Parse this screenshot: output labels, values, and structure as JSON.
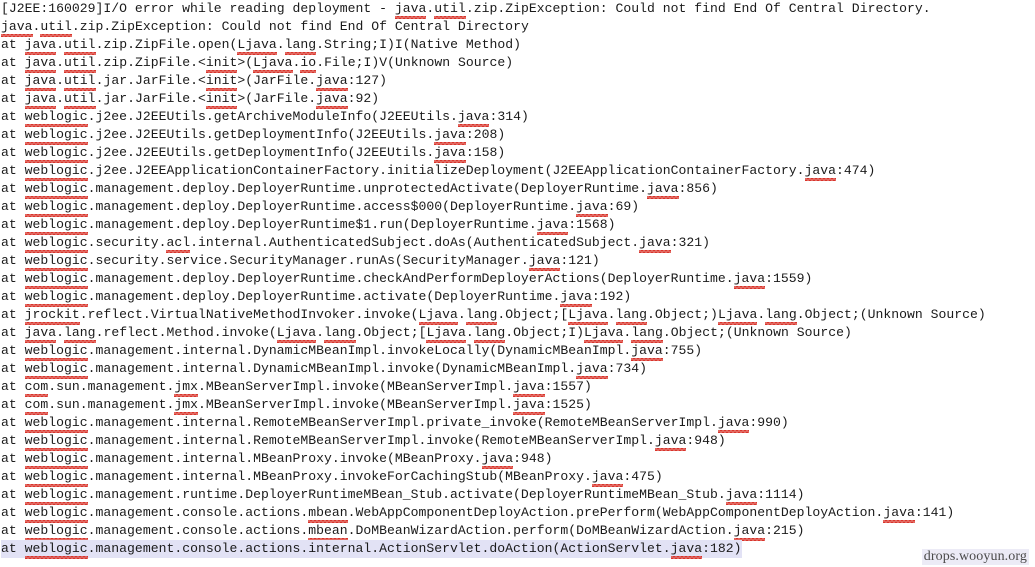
{
  "document": {
    "kind": "java-exception-stack-trace",
    "watermark": "drops.wooyun.org"
  },
  "trace": {
    "lines": [
      {
        "text": "[J2EE:160029]I/O error while reading deployment - java.util.zip.ZipException: Could not find End Of Central Directory.",
        "selected": false,
        "misspelled": [
          "java",
          "util",
          "java",
          "util"
        ]
      },
      {
        "text": "java.util.zip.ZipException: Could not find End Of Central Directory",
        "selected": false,
        "misspelled": [
          "java",
          "util"
        ]
      },
      {
        "text": "at java.util.zip.ZipFile.open(Ljava.lang.String;I)I(Native Method)",
        "selected": false,
        "misspelled": [
          "java",
          "util",
          "Ljava",
          "lang"
        ]
      },
      {
        "text": "at java.util.zip.ZipFile.<init>(Ljava.io.File;I)V(Unknown Source)",
        "selected": false,
        "misspelled": [
          "java",
          "util",
          "init",
          "Ljava",
          "io"
        ]
      },
      {
        "text": "at java.util.jar.JarFile.<init>(JarFile.java:127)",
        "selected": false,
        "misspelled": [
          "java",
          "util",
          "init",
          "java"
        ]
      },
      {
        "text": "at java.util.jar.JarFile.<init>(JarFile.java:92)",
        "selected": false,
        "misspelled": [
          "java",
          "util",
          "init",
          "java"
        ]
      },
      {
        "text": "at weblogic.j2ee.J2EEUtils.getArchiveModuleInfo(J2EEUtils.java:314)",
        "selected": false,
        "misspelled": [
          "weblogic",
          "java"
        ]
      },
      {
        "text": "at weblogic.j2ee.J2EEUtils.getDeploymentInfo(J2EEUtils.java:208)",
        "selected": false,
        "misspelled": [
          "weblogic",
          "java"
        ]
      },
      {
        "text": "at weblogic.j2ee.J2EEUtils.getDeploymentInfo(J2EEUtils.java:158)",
        "selected": false,
        "misspelled": [
          "weblogic",
          "java"
        ]
      },
      {
        "text": "at weblogic.j2ee.J2EEApplicationContainerFactory.initializeDeployment(J2EEApplicationContainerFactory.java:474)",
        "selected": false,
        "misspelled": [
          "weblogic",
          "java"
        ]
      },
      {
        "text": "at weblogic.management.deploy.DeployerRuntime.unprotectedActivate(DeployerRuntime.java:856)",
        "selected": false,
        "misspelled": [
          "weblogic",
          "java"
        ]
      },
      {
        "text": "at weblogic.management.deploy.DeployerRuntime.access$000(DeployerRuntime.java:69)",
        "selected": false,
        "misspelled": [
          "weblogic",
          "java"
        ]
      },
      {
        "text": "at weblogic.management.deploy.DeployerRuntime$1.run(DeployerRuntime.java:1568)",
        "selected": false,
        "misspelled": [
          "weblogic",
          "java"
        ]
      },
      {
        "text": "at weblogic.security.acl.internal.AuthenticatedSubject.doAs(AuthenticatedSubject.java:321)",
        "selected": false,
        "misspelled": [
          "weblogic",
          "acl",
          "java"
        ]
      },
      {
        "text": "at weblogic.security.service.SecurityManager.runAs(SecurityManager.java:121)",
        "selected": false,
        "misspelled": [
          "weblogic",
          "java"
        ]
      },
      {
        "text": "at weblogic.management.deploy.DeployerRuntime.checkAndPerformDeployerActions(DeployerRuntime.java:1559)",
        "selected": false,
        "misspelled": [
          "weblogic",
          "java"
        ]
      },
      {
        "text": "at weblogic.management.deploy.DeployerRuntime.activate(DeployerRuntime.java:192)",
        "selected": false,
        "misspelled": [
          "weblogic",
          "java"
        ]
      },
      {
        "text": "at jrockit.reflect.VirtualNativeMethodInvoker.invoke(Ljava.lang.Object;[Ljava.lang.Object;)Ljava.lang.Object;(Unknown Source)",
        "selected": false,
        "misspelled": [
          "jrockit",
          "Ljava",
          "lang",
          "Ljava",
          "lang",
          "Ljava",
          "lang"
        ]
      },
      {
        "text": "at java.lang.reflect.Method.invoke(Ljava.lang.Object;[Ljava.lang.Object;I)Ljava.lang.Object;(Unknown Source)",
        "selected": false,
        "misspelled": [
          "java",
          "lang",
          "Ljava",
          "lang",
          "Ljava",
          "lang",
          "Ljava",
          "lang"
        ]
      },
      {
        "text": "at weblogic.management.internal.DynamicMBeanImpl.invokeLocally(DynamicMBeanImpl.java:755)",
        "selected": false,
        "misspelled": [
          "weblogic",
          "java"
        ]
      },
      {
        "text": "at weblogic.management.internal.DynamicMBeanImpl.invoke(DynamicMBeanImpl.java:734)",
        "selected": false,
        "misspelled": [
          "weblogic",
          "java"
        ]
      },
      {
        "text": "at com.sun.management.jmx.MBeanServerImpl.invoke(MBeanServerImpl.java:1557)",
        "selected": false,
        "misspelled": [
          "com",
          "jmx",
          "java"
        ]
      },
      {
        "text": "at com.sun.management.jmx.MBeanServerImpl.invoke(MBeanServerImpl.java:1525)",
        "selected": false,
        "misspelled": [
          "com",
          "jmx",
          "java"
        ]
      },
      {
        "text": "at weblogic.management.internal.RemoteMBeanServerImpl.private_invoke(RemoteMBeanServerImpl.java:990)",
        "selected": false,
        "misspelled": [
          "weblogic",
          "java"
        ]
      },
      {
        "text": "at weblogic.management.internal.RemoteMBeanServerImpl.invoke(RemoteMBeanServerImpl.java:948)",
        "selected": false,
        "misspelled": [
          "weblogic",
          "java"
        ]
      },
      {
        "text": "at weblogic.management.internal.MBeanProxy.invoke(MBeanProxy.java:948)",
        "selected": false,
        "misspelled": [
          "weblogic",
          "java"
        ]
      },
      {
        "text": "at weblogic.management.internal.MBeanProxy.invokeForCachingStub(MBeanProxy.java:475)",
        "selected": false,
        "misspelled": [
          "weblogic",
          "java"
        ]
      },
      {
        "text": "at weblogic.management.runtime.DeployerRuntimeMBean_Stub.activate(DeployerRuntimeMBean_Stub.java:1114)",
        "selected": false,
        "misspelled": [
          "weblogic",
          "java"
        ]
      },
      {
        "text": "at weblogic.management.console.actions.mbean.WebAppComponentDeployAction.prePerform(WebAppComponentDeployAction.java:141)",
        "selected": false,
        "misspelled": [
          "weblogic",
          "mbean",
          "java"
        ]
      },
      {
        "text": "at weblogic.management.console.actions.mbean.DoMBeanWizardAction.perform(DoMBeanWizardAction.java:215)",
        "selected": false,
        "misspelled": [
          "weblogic",
          "mbean",
          "java"
        ]
      },
      {
        "text": "at weblogic.management.console.actions.internal.ActionServlet.doAction(ActionServlet.java:182)",
        "selected": true,
        "misspelled": [
          "weblogic",
          "java"
        ]
      }
    ]
  },
  "colors": {
    "background": "#ffffff",
    "text": "#1a1a1a",
    "spellcheck_underline": "#d9342b",
    "selection_highlight": "#e2e2f5",
    "watermark_text": "#4a4a4a"
  }
}
